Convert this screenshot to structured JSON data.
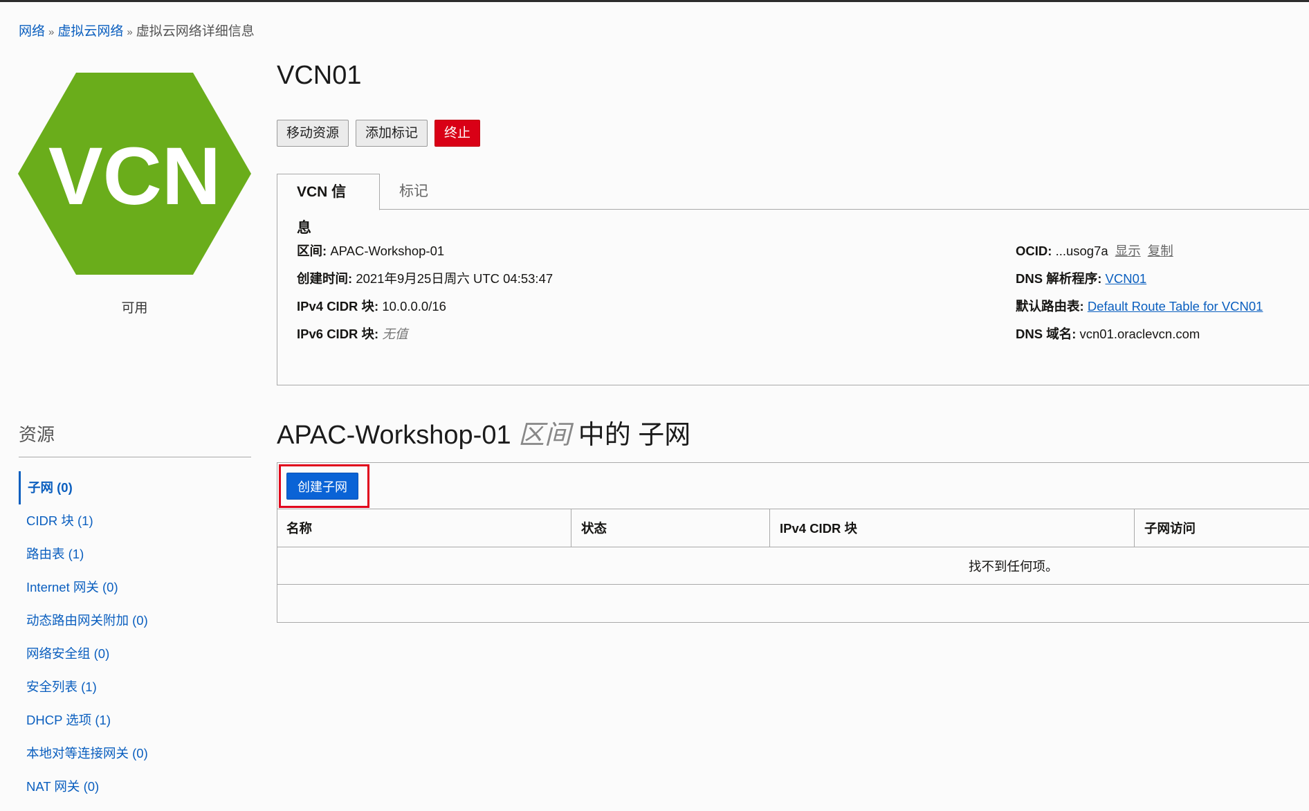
{
  "breadcrumb": {
    "items": [
      "网络",
      "虚拟云网络"
    ],
    "current": "虚拟云网络详细信息",
    "separator": "»"
  },
  "resource_icon": {
    "text": "VCN",
    "color": "#6aad1b"
  },
  "status": "可用",
  "title": "VCN01",
  "actions": {
    "move": "移动资源",
    "add_tag": "添加标记",
    "terminate": "终止"
  },
  "tabs": [
    "VCN 信息",
    "标记"
  ],
  "info": {
    "left": [
      {
        "label": "区间:",
        "value": "APAC-Workshop-01"
      },
      {
        "label": "创建时间:",
        "value": "2021年9月25日周六 UTC 04:53:47"
      },
      {
        "label": "IPv4 CIDR 块:",
        "value": "10.0.0.0/16"
      },
      {
        "label": "IPv6 CIDR 块:",
        "value": "无值"
      }
    ],
    "right": {
      "ocid": {
        "label": "OCID:",
        "value": "...usog7a",
        "show": "显示",
        "copy": "复制"
      },
      "dns_resolver": {
        "label": "DNS 解析程序:",
        "value": "VCN01"
      },
      "route_table": {
        "label": "默认路由表:",
        "value": "Default Route Table for VCN01"
      },
      "dns_domain": {
        "label": "DNS 域名:",
        "value": "vcn01.oraclevcn.com"
      }
    }
  },
  "sidebar": {
    "title": "资源",
    "items": [
      {
        "label": "子网 (0)"
      },
      {
        "label": "CIDR 块 (1)"
      },
      {
        "label": "路由表 (1)"
      },
      {
        "label": "Internet 网关 (0)"
      },
      {
        "label": "动态路由网关附加 (0)"
      },
      {
        "label": "网络安全组 (0)"
      },
      {
        "label": "安全列表 (1)"
      },
      {
        "label": "DHCP 选项 (1)"
      },
      {
        "label": "本地对等连接网关 (0)"
      },
      {
        "label": "NAT 网关 (0)"
      }
    ]
  },
  "subnets": {
    "title_compartment": "APAC-Workshop-01",
    "title_scope": "区间",
    "title_suffix": "中的 子网",
    "create_button": "创建子网",
    "columns": [
      "名称",
      "状态",
      "IPv4 CIDR 块",
      "子网访问"
    ],
    "empty_text": "找不到任何项。"
  },
  "colors": {
    "link": "#0b5fbf",
    "danger": "#d90016",
    "primary": "#0a63d6",
    "highlight": "#e0001b"
  }
}
